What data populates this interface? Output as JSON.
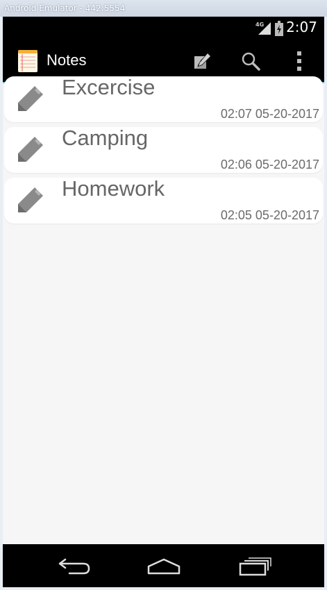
{
  "window": {
    "title": "Android Emulator - 442:5554"
  },
  "status_bar": {
    "network": "4G",
    "time": "2:07"
  },
  "action_bar": {
    "title": "Notes",
    "icons": [
      "notes-app-icon",
      "compose-icon",
      "search-icon",
      "overflow-menu-icon"
    ]
  },
  "notes": [
    {
      "title": "Excercise",
      "date": "02:07 05-20-2017"
    },
    {
      "title": "Camping",
      "date": "02:06 05-20-2017"
    },
    {
      "title": "Homework",
      "date": "02:05 05-20-2017"
    }
  ],
  "nav_bar": {
    "icons": [
      "back-icon",
      "home-icon",
      "recents-icon"
    ]
  },
  "colors": {
    "accent": "#6cc6e8",
    "background": "#f6f6f6",
    "text": "#666666"
  }
}
